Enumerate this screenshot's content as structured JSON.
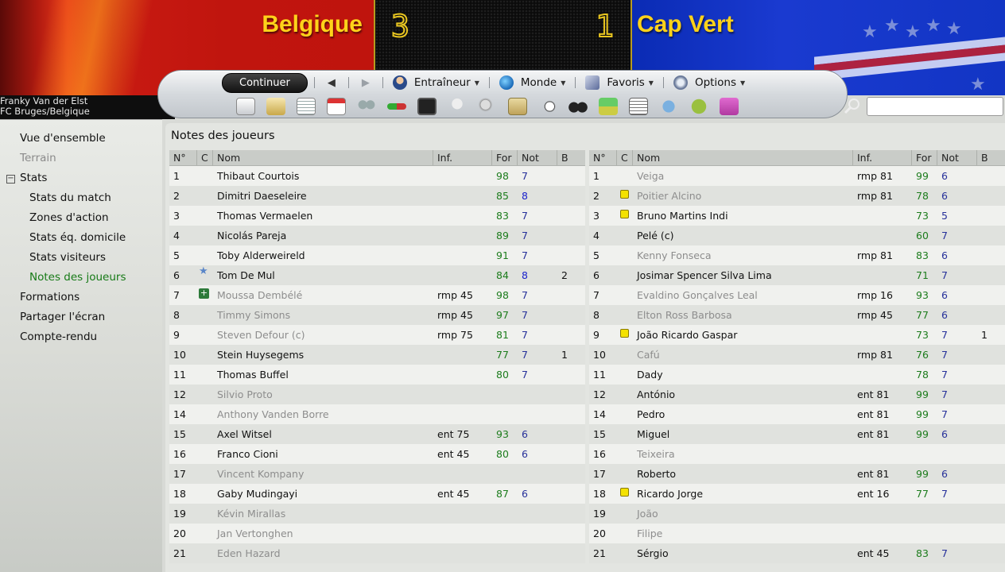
{
  "match": {
    "home_team": "Belgique",
    "away_team": "Cap Vert",
    "home_score": "3",
    "away_score": "1"
  },
  "manager": {
    "name": "Franky Van der Elst",
    "club": "FC Bruges/Belgique"
  },
  "toolbar": {
    "continue_label": "Continuer",
    "menus": [
      {
        "label": "Entraîneur",
        "icon": "manager-icon"
      },
      {
        "label": "Monde",
        "icon": "globe-icon"
      },
      {
        "label": "Favoris",
        "icon": "bookmark-icon"
      },
      {
        "label": "Options",
        "icon": "gears-icon"
      }
    ],
    "icons": [
      "home-icon",
      "inbox-icon",
      "news-icon",
      "calendar-icon",
      "squad-icon",
      "transfers-icon",
      "tactics-icon",
      "trophy-icon",
      "scout-icon",
      "clipboard-icon",
      "match-icon",
      "binoculars-icon",
      "finances-icon",
      "report-icon",
      "world-icon",
      "help-icon",
      "about-icon"
    ]
  },
  "sidebar": {
    "items": [
      {
        "label": "Vue d'ensemble",
        "state": "normal"
      },
      {
        "label": "Terrain",
        "state": "disabled"
      },
      {
        "label": "Stats",
        "state": "normal"
      },
      {
        "label": "Stats du match",
        "state": "normal"
      },
      {
        "label": "Zones d'action",
        "state": "normal"
      },
      {
        "label": "Stats éq. domicile",
        "state": "normal"
      },
      {
        "label": "Stats visiteurs",
        "state": "normal"
      },
      {
        "label": "Notes des joueurs",
        "state": "active"
      },
      {
        "label": "Formations",
        "state": "normal"
      },
      {
        "label": "Partager l'écran",
        "state": "normal"
      },
      {
        "label": "Compte-rendu",
        "state": "normal"
      }
    ]
  },
  "main": {
    "title": "Notes des joueurs",
    "columns": [
      "N°",
      "C",
      "Nom",
      "Inf.",
      "For",
      "Not",
      "B"
    ],
    "home_players": [
      {
        "num": "1",
        "icon": "",
        "name": "Thibaut Courtois",
        "inf": "",
        "for": "98",
        "not": "7",
        "b": "",
        "sub": false
      },
      {
        "num": "2",
        "icon": "",
        "name": "Dimitri Daeseleire",
        "inf": "",
        "for": "85",
        "not": "8",
        "b": "",
        "sub": false
      },
      {
        "num": "3",
        "icon": "",
        "name": "Thomas Vermaelen",
        "inf": "",
        "for": "83",
        "not": "7",
        "b": "",
        "sub": false
      },
      {
        "num": "4",
        "icon": "",
        "name": "Nicolás Pareja",
        "inf": "",
        "for": "89",
        "not": "7",
        "b": "",
        "sub": false
      },
      {
        "num": "5",
        "icon": "",
        "name": "Toby Alderweireld",
        "inf": "",
        "for": "91",
        "not": "7",
        "b": "",
        "sub": false
      },
      {
        "num": "6",
        "icon": "star",
        "name": "Tom De Mul",
        "inf": "",
        "for": "84",
        "not": "8",
        "b": "2",
        "sub": false
      },
      {
        "num": "7",
        "icon": "plus",
        "name": "Moussa Dembélé",
        "inf": "rmp 45",
        "for": "98",
        "not": "7",
        "b": "",
        "sub": true
      },
      {
        "num": "8",
        "icon": "",
        "name": "Timmy Simons",
        "inf": "rmp 45",
        "for": "97",
        "not": "7",
        "b": "",
        "sub": true
      },
      {
        "num": "9",
        "icon": "",
        "name": "Steven Defour (c)",
        "inf": "rmp 75",
        "for": "81",
        "not": "7",
        "b": "",
        "sub": true
      },
      {
        "num": "10",
        "icon": "",
        "name": "Stein Huysegems",
        "inf": "",
        "for": "77",
        "not": "7",
        "b": "1",
        "sub": false
      },
      {
        "num": "11",
        "icon": "",
        "name": "Thomas Buffel",
        "inf": "",
        "for": "80",
        "not": "7",
        "b": "",
        "sub": false
      },
      {
        "num": "12",
        "icon": "",
        "name": "Silvio Proto",
        "inf": "",
        "for": "",
        "not": "",
        "b": "",
        "sub": true
      },
      {
        "num": "14",
        "icon": "",
        "name": "Anthony Vanden Borre",
        "inf": "",
        "for": "",
        "not": "",
        "b": "",
        "sub": true
      },
      {
        "num": "15",
        "icon": "",
        "name": "Axel Witsel",
        "inf": "ent 75",
        "for": "93",
        "not": "6",
        "b": "",
        "sub": false
      },
      {
        "num": "16",
        "icon": "",
        "name": "Franco Cioni",
        "inf": "ent 45",
        "for": "80",
        "not": "6",
        "b": "",
        "sub": false
      },
      {
        "num": "17",
        "icon": "",
        "name": "Vincent Kompany",
        "inf": "",
        "for": "",
        "not": "",
        "b": "",
        "sub": true
      },
      {
        "num": "18",
        "icon": "",
        "name": "Gaby Mudingayi",
        "inf": "ent 45",
        "for": "87",
        "not": "6",
        "b": "",
        "sub": false
      },
      {
        "num": "19",
        "icon": "",
        "name": "Kévin Mirallas",
        "inf": "",
        "for": "",
        "not": "",
        "b": "",
        "sub": true
      },
      {
        "num": "20",
        "icon": "",
        "name": "Jan Vertonghen",
        "inf": "",
        "for": "",
        "not": "",
        "b": "",
        "sub": true
      },
      {
        "num": "21",
        "icon": "",
        "name": "Eden Hazard",
        "inf": "",
        "for": "",
        "not": "",
        "b": "",
        "sub": true
      }
    ],
    "away_players": [
      {
        "num": "1",
        "icon": "",
        "name": "Veiga",
        "inf": "rmp 81",
        "for": "99",
        "not": "6",
        "b": "",
        "sub": true
      },
      {
        "num": "2",
        "icon": "yellow",
        "name": "Poitier Alcino",
        "inf": "rmp 81",
        "for": "78",
        "not": "6",
        "b": "",
        "sub": true
      },
      {
        "num": "3",
        "icon": "yellow",
        "name": "Bruno Martins Indi",
        "inf": "",
        "for": "73",
        "not": "5",
        "b": "",
        "sub": false
      },
      {
        "num": "4",
        "icon": "",
        "name": "Pelé (c)",
        "inf": "",
        "for": "60",
        "not": "7",
        "b": "",
        "sub": false
      },
      {
        "num": "5",
        "icon": "",
        "name": "Kenny Fonseca",
        "inf": "rmp 81",
        "for": "83",
        "not": "6",
        "b": "",
        "sub": true
      },
      {
        "num": "6",
        "icon": "",
        "name": "Josimar Spencer Silva Lima",
        "inf": "",
        "for": "71",
        "not": "7",
        "b": "",
        "sub": false
      },
      {
        "num": "7",
        "icon": "",
        "name": "Evaldino Gonçalves Leal",
        "inf": "rmp 16",
        "for": "93",
        "not": "6",
        "b": "",
        "sub": true
      },
      {
        "num": "8",
        "icon": "",
        "name": "Elton Ross Barbosa",
        "inf": "rmp 45",
        "for": "77",
        "not": "6",
        "b": "",
        "sub": true
      },
      {
        "num": "9",
        "icon": "yellow",
        "name": "João Ricardo Gaspar",
        "inf": "",
        "for": "73",
        "not": "7",
        "b": "1",
        "sub": false
      },
      {
        "num": "10",
        "icon": "",
        "name": "Cafú",
        "inf": "rmp 81",
        "for": "76",
        "not": "7",
        "b": "",
        "sub": true
      },
      {
        "num": "11",
        "icon": "",
        "name": "Dady",
        "inf": "",
        "for": "78",
        "not": "7",
        "b": "",
        "sub": false
      },
      {
        "num": "12",
        "icon": "",
        "name": "António",
        "inf": "ent 81",
        "for": "99",
        "not": "7",
        "b": "",
        "sub": false
      },
      {
        "num": "14",
        "icon": "",
        "name": "Pedro",
        "inf": "ent 81",
        "for": "99",
        "not": "7",
        "b": "",
        "sub": false
      },
      {
        "num": "15",
        "icon": "",
        "name": "Miguel",
        "inf": "ent 81",
        "for": "99",
        "not": "6",
        "b": "",
        "sub": false
      },
      {
        "num": "16",
        "icon": "",
        "name": "Teixeira",
        "inf": "",
        "for": "",
        "not": "",
        "b": "",
        "sub": true
      },
      {
        "num": "17",
        "icon": "",
        "name": "Roberto",
        "inf": "ent 81",
        "for": "99",
        "not": "6",
        "b": "",
        "sub": false
      },
      {
        "num": "18",
        "icon": "yellow",
        "name": "Ricardo Jorge",
        "inf": "ent 16",
        "for": "77",
        "not": "7",
        "b": "",
        "sub": false
      },
      {
        "num": "19",
        "icon": "",
        "name": "João",
        "inf": "",
        "for": "",
        "not": "",
        "b": "",
        "sub": true
      },
      {
        "num": "20",
        "icon": "",
        "name": "Filipe",
        "inf": "",
        "for": "",
        "not": "",
        "b": "",
        "sub": true
      },
      {
        "num": "21",
        "icon": "",
        "name": "Sérgio",
        "inf": "ent 45",
        "for": "83",
        "not": "7",
        "b": "",
        "sub": false
      }
    ]
  },
  "colors": {
    "home_red": "#c0150e",
    "away_blue": "#1235c4",
    "team_name_yellow": "#ffd21a",
    "rating_green": "#1c7c1c",
    "note_blue": "#26309a",
    "active_green": "#167a16"
  }
}
